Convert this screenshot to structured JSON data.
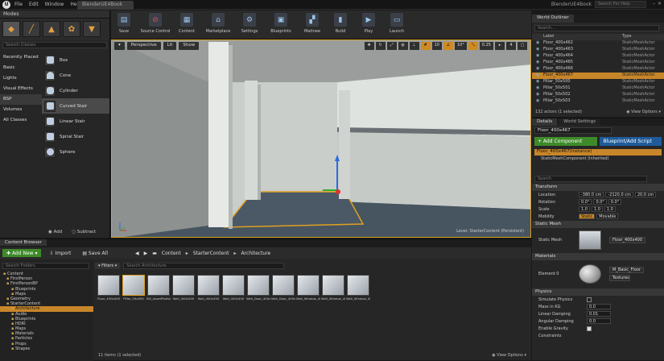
{
  "titlebar": {
    "tab": "BlenderUE4Book",
    "project": "BlenderUE4Book",
    "search_placeholder": "Search For Help",
    "menu": [
      "File",
      "Edit",
      "Window",
      "Help"
    ]
  },
  "modes": {
    "title": "Modes",
    "search_placeholder": "Search Classes",
    "categories": [
      "Recently Placed",
      "Basic",
      "Lights",
      "Visual Effects",
      "BSP",
      "Volumes",
      "All Classes"
    ],
    "selected_category": 4,
    "items": [
      "Box",
      "Cone",
      "Cylinder",
      "Curved Stair",
      "Linear Stair",
      "Spiral Stair",
      "Sphere"
    ],
    "selected_item": 3,
    "add_label": "Add",
    "subtract_label": "Subtract"
  },
  "toolbar": {
    "buttons": [
      "Save",
      "Source Control",
      "Content",
      "Marketplace",
      "Settings",
      "Blueprints",
      "Matinee",
      "Build",
      "Play",
      "Launch"
    ]
  },
  "viewport": {
    "perspective": "Perspective",
    "lit": "Lit",
    "show": "Show",
    "snap_rot": "10°",
    "snap_scale": "0.25",
    "cam_speed": "4",
    "level": "Level: StarterContent (Persistent)"
  },
  "outliner": {
    "title": "World Outliner",
    "search_placeholder": "Search...",
    "col_label": "Label",
    "col_type": "Type",
    "rows": [
      {
        "label": "Floor_400x462",
        "type": "StaticMeshActor"
      },
      {
        "label": "Floor_400x463",
        "type": "StaticMeshActor"
      },
      {
        "label": "Floor_400x464",
        "type": "StaticMeshActor"
      },
      {
        "label": "Floor_400x465",
        "type": "StaticMeshActor"
      },
      {
        "label": "Floor_400x466",
        "type": "StaticMeshActor"
      },
      {
        "label": "Floor_400x467",
        "type": "StaticMeshActor"
      },
      {
        "label": "Pillar_50x500",
        "type": "StaticMeshActor"
      },
      {
        "label": "Pillar_50x501",
        "type": "StaticMeshActor"
      },
      {
        "label": "Pillar_50x502",
        "type": "StaticMeshActor"
      },
      {
        "label": "Pillar_50x503",
        "type": "StaticMeshActor"
      }
    ],
    "selected_row": 5,
    "footer_count": "132 actors (1 selected)",
    "view_options": "View Options"
  },
  "details": {
    "tab": "Details",
    "tab2": "World Settings",
    "name": "Floor_400x467",
    "add_component": "+ Add Component",
    "blueprint_script": "Blueprint/Add Script",
    "instance": "Floor_400x467(Instance)",
    "component": "StaticMeshComponent (Inherited)",
    "search_placeholder": "Search",
    "transform": "Transform",
    "location_label": "Location",
    "location": [
      "-380.0 cm",
      "-2120.0 cm",
      "20.0 cm"
    ],
    "rotation_label": "Rotation",
    "rotation": [
      "0.0°",
      "0.0°",
      "0.0°"
    ],
    "scale_label": "Scale",
    "scale": [
      "1.0",
      "1.0",
      "1.0"
    ],
    "mobility_label": "Mobility",
    "mobility_static": "Static",
    "mobility_movable": "Movable",
    "static_mesh_section": "Static Mesh",
    "static_mesh_label": "Static Mesh",
    "static_mesh_value": "Floor_400x400",
    "materials_section": "Materials",
    "element_label": "Element 0",
    "material_value": "M_Basic_Floor",
    "textures_label": "Textures",
    "physics_section": "Physics",
    "physics": [
      {
        "label": "Simulate Physics",
        "value": ""
      },
      {
        "label": "Mass in KG",
        "value": "0.0"
      },
      {
        "label": "Linear Damping",
        "value": "0.01"
      },
      {
        "label": "Angular Damping",
        "value": "0.0"
      },
      {
        "label": "Enable Gravity",
        "value": ""
      },
      {
        "label": "Constraints",
        "value": ""
      }
    ]
  },
  "content_browser": {
    "tab": "Content Browser",
    "add_new": "Add New",
    "import": "Import",
    "save_all": "Save All",
    "path": [
      "Content",
      "StarterContent",
      "Architecture"
    ],
    "search_folders_placeholder": "Search Folders",
    "tree": [
      "Content",
      "FirstPerson",
      "FirstPersonBP",
      "Blueprints",
      "Maps",
      "Geometry",
      "StarterContent",
      "Architecture",
      "Audio",
      "Blueprints",
      "HDRI",
      "Maps",
      "Materials",
      "Particles",
      "Props",
      "Shapes"
    ],
    "selected_tree": 7,
    "filters_label": "Filters",
    "search_placeholder": "Search Architecture",
    "assets": [
      "Floor_400x400",
      "Pillar_50x500",
      "SM_AssetPlatform",
      "Wall_400x200",
      "Wall_400x300",
      "Wall_400x400",
      "Wall_Door_400x300",
      "Wall_Door_400x400",
      "Wall_Window_400x300",
      "Wall_Window_400x400",
      "Wall_Window_400x400"
    ],
    "selected_asset": 1,
    "footer_count": "11 items (1 selected)",
    "view_options": "View Options"
  }
}
